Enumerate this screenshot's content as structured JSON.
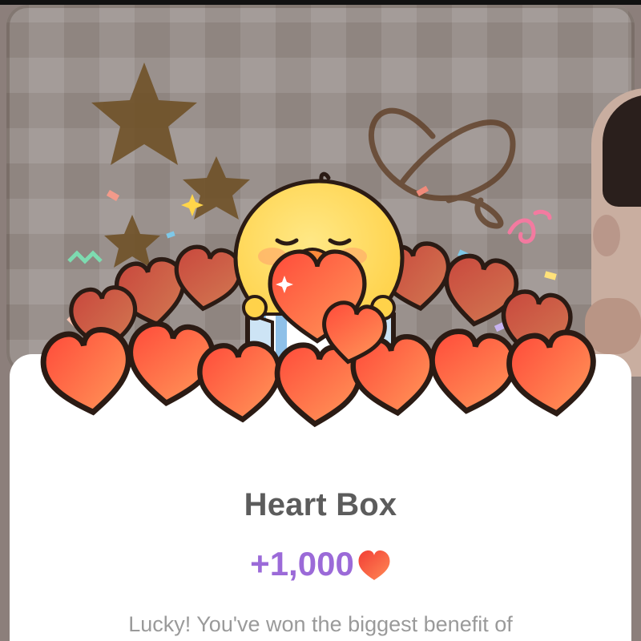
{
  "modal": {
    "title": "Heart Box",
    "reward": {
      "amount": "+1,000",
      "icon": "heart-icon"
    },
    "description": "Lucky! You've won the biggest benefit of"
  },
  "illustration": {
    "character": "chick-character",
    "objects": [
      "hearts-pile",
      "gift-box",
      "stars",
      "confetti"
    ]
  },
  "colors": {
    "title": "#5c5c5c",
    "reward": "#9b6ad8",
    "description": "#9a9a9a",
    "heart": "#f2573f",
    "card_bg": "#ffffff"
  }
}
